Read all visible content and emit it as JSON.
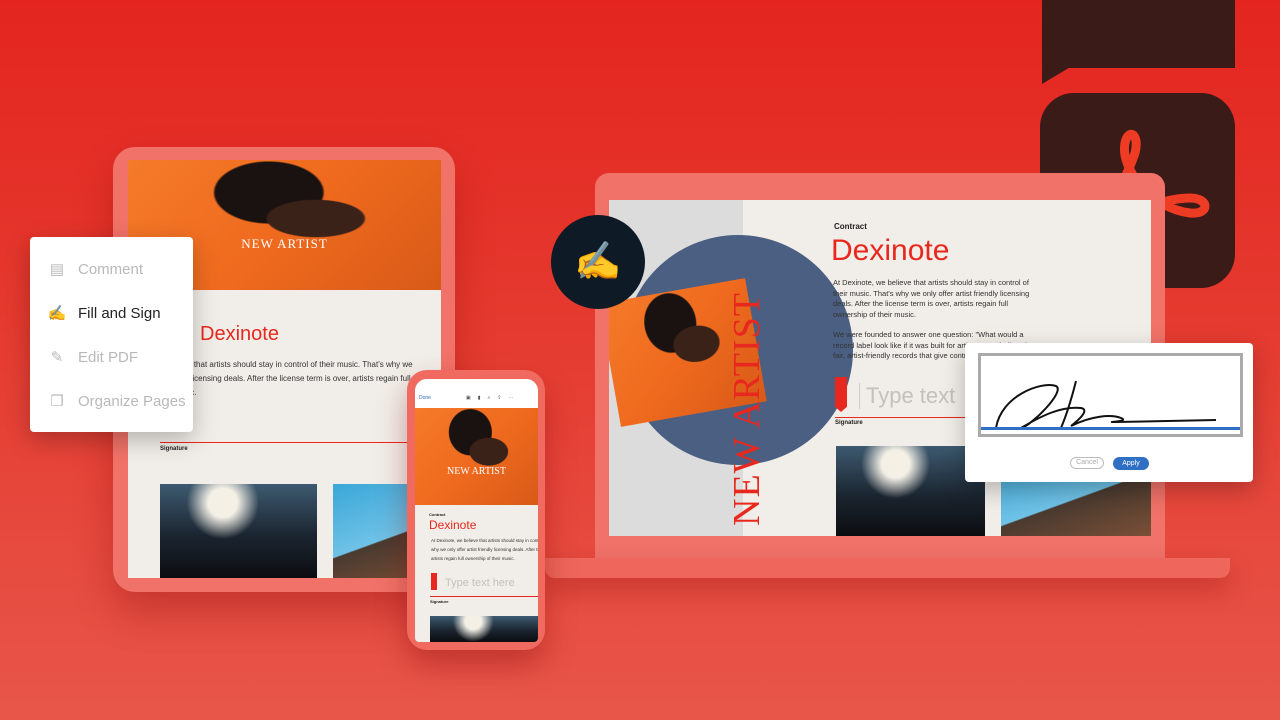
{
  "brand": {
    "logo": "adobe-acrobat",
    "colors": {
      "background": "#e4251f",
      "icon_bg": "#3a1b17",
      "accent_red": "#e8281e",
      "apply_blue": "#2f6fc4"
    }
  },
  "menu": {
    "items": [
      {
        "label": "Comment",
        "icon": "comment-icon",
        "active": false
      },
      {
        "label": "Fill and Sign",
        "icon": "pen-sign-icon",
        "active": true
      },
      {
        "label": "Edit PDF",
        "icon": "pencil-icon",
        "active": false
      },
      {
        "label": "Organize Pages",
        "icon": "pages-icon",
        "active": false
      }
    ]
  },
  "tablet": {
    "banner": "NEW ARTIST",
    "title": "Dexinote",
    "body": "At Dexinote, we believe that artists should stay in control of their music. That's why we only offer artist friendly licensing deals. After the license term is over, artists regain full ownership of their music.",
    "signature_label": "Signature"
  },
  "phone": {
    "toolbar": {
      "done": "Done"
    },
    "banner": "NEW ARTIST",
    "label": "Contract",
    "title": "Dexinote",
    "body": "At Dexinote, we believe that artists should stay in control of their music. That's why we only offer artist friendly licensing deals. After the license term is over, artists regain full ownership of their music.",
    "placeholder": "Type text here",
    "signature_label": "Signature"
  },
  "laptop": {
    "vertical_title": "NEW ARTIST",
    "label": "Contract",
    "title": "Dexinote",
    "body1": "At Dexinote, we believe that artists should stay in control of their music. That's why we only offer artist friendly licensing deals. After the license term is over, artists regain full ownership of their music.",
    "body2": "We were founded to answer one question: \"What would a record label look like if it was built for artists?\" We believe in fair, artist-friendly records that give control back to artists.",
    "placeholder": "Type text",
    "signature_label": "Signature"
  },
  "dialog": {
    "cancel": "Cancel",
    "apply": "Apply"
  }
}
